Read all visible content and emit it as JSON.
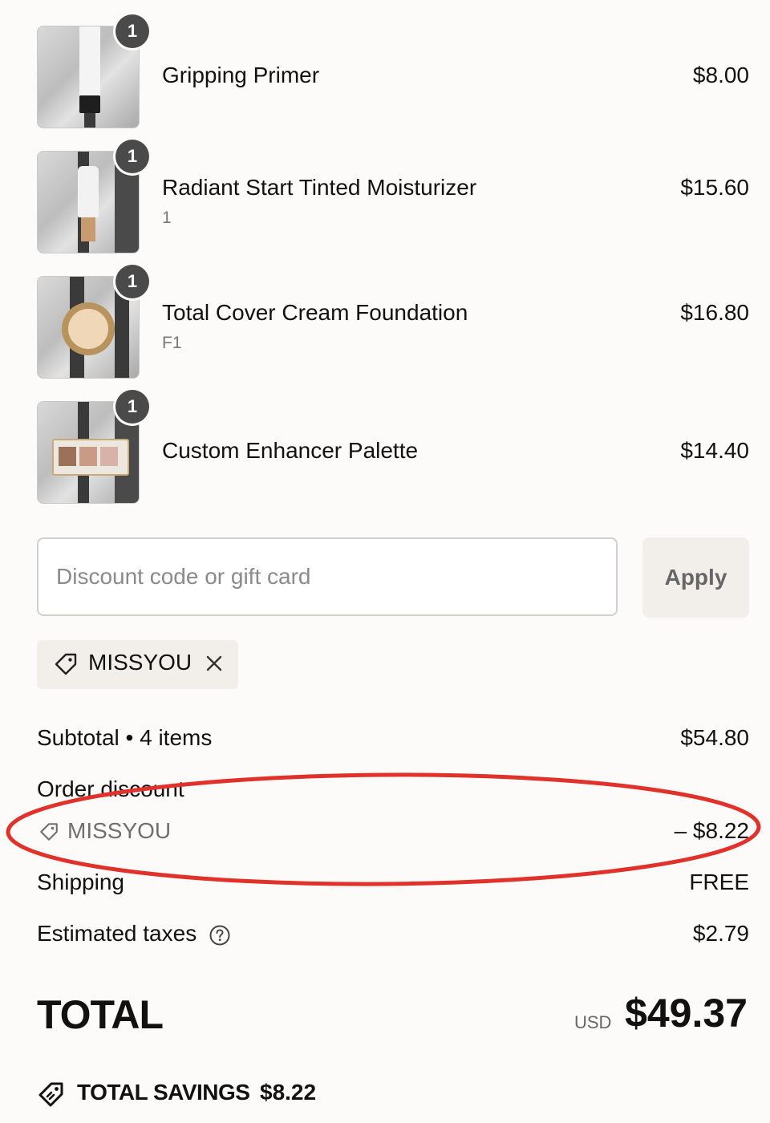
{
  "items": [
    {
      "name": "Gripping Primer",
      "variant": "",
      "price": "$8.00",
      "quantity": "1"
    },
    {
      "name": "Radiant Start Tinted Moisturizer",
      "variant": "1",
      "price": "$15.60",
      "quantity": "1"
    },
    {
      "name": "Total Cover Cream Foundation",
      "variant": "F1",
      "price": "$16.80",
      "quantity": "1"
    },
    {
      "name": "Custom Enhancer Palette",
      "variant": "",
      "price": "$14.40",
      "quantity": "1"
    }
  ],
  "discount": {
    "placeholder": "Discount code or gift card",
    "apply_label": "Apply",
    "applied_code": "MISSYOU"
  },
  "summary": {
    "subtotal_label": "Subtotal • 4 items",
    "subtotal_value": "$54.80",
    "order_discount_label": "Order discount",
    "discount_code": "MISSYOU",
    "discount_value": "– $8.22",
    "shipping_label": "Shipping",
    "shipping_value": "FREE",
    "taxes_label": "Estimated taxes",
    "taxes_value": "$2.79"
  },
  "total": {
    "label": "TOTAL",
    "currency": "USD",
    "value": "$49.37"
  },
  "savings": {
    "label": "TOTAL SAVINGS",
    "value": "$8.22"
  },
  "colors": {
    "background": "#fcfbf9",
    "annotation": "#e0322a",
    "badge": "#4a4a4a"
  }
}
